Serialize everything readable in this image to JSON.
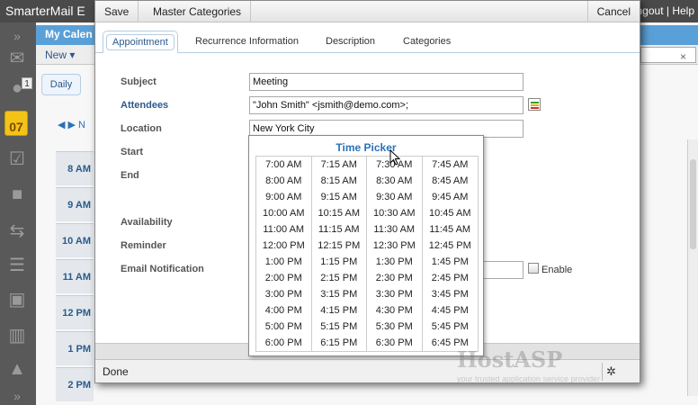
{
  "app": {
    "title": "SmarterMail E",
    "top_links": "ngout | Help",
    "header_title": "My Calen",
    "new_label": "New",
    "daily_tab": "Daily",
    "nav_month": "N",
    "inbox_count": "1",
    "calendar_day": "07",
    "time_slots": [
      "8 AM",
      "9 AM",
      "10 AM",
      "11 AM",
      "12 PM",
      "1 PM",
      "2 PM"
    ]
  },
  "modal": {
    "toolbar": {
      "save": "Save",
      "master_categories": "Master Categories",
      "cancel": "Cancel"
    },
    "tabs": [
      {
        "label": "Appointment",
        "active": true
      },
      {
        "label": "Recurrence Information",
        "active": false
      },
      {
        "label": "Description",
        "active": false
      },
      {
        "label": "Categories",
        "active": false
      }
    ],
    "fields": {
      "subject_label": "Subject",
      "subject_value": "Meeting",
      "attendees_label": "Attendees",
      "attendees_value": "\"John Smith\" <jsmith@demo.com>;",
      "location_label": "Location",
      "location_value": "New York City",
      "start_label": "Start",
      "end_label": "End",
      "availability_label": "Availability",
      "reminder_label": "Reminder",
      "email_notification_label": "Email Notification",
      "enable_label": "Enable"
    },
    "status": "Done"
  },
  "time_picker": {
    "title": "Time Picker",
    "times": [
      "7:00 AM",
      "7:15 AM",
      "7:30 AM",
      "7:45 AM",
      "8:00 AM",
      "8:15 AM",
      "8:30 AM",
      "8:45 AM",
      "9:00 AM",
      "9:15 AM",
      "9:30 AM",
      "9:45 AM",
      "10:00 AM",
      "10:15 AM",
      "10:30 AM",
      "10:45 AM",
      "11:00 AM",
      "11:15 AM",
      "11:30 AM",
      "11:45 AM",
      "12:00 PM",
      "12:15 PM",
      "12:30 PM",
      "12:45 PM",
      "1:00 PM",
      "1:15 PM",
      "1:30 PM",
      "1:45 PM",
      "2:00 PM",
      "2:15 PM",
      "2:30 PM",
      "2:45 PM",
      "3:00 PM",
      "3:15 PM",
      "3:30 PM",
      "3:45 PM",
      "4:00 PM",
      "4:15 PM",
      "4:30 PM",
      "4:45 PM",
      "5:00 PM",
      "5:15 PM",
      "5:30 PM",
      "5:45 PM",
      "6:00 PM",
      "6:15 PM",
      "6:30 PM",
      "6:45 PM"
    ]
  },
  "watermark": {
    "brand": "HostASP",
    "tagline": "your trusted application service provider"
  },
  "colors": {
    "accent_blue": "#2b73b8",
    "header_blue": "#5aa0d8",
    "rail_gray": "#595959"
  },
  "icons": [
    "chevron-double-down-icon",
    "mail-icon",
    "contacts-icon",
    "calendar-icon",
    "tasks-icon",
    "notes-icon",
    "sync-icon",
    "rss-icon",
    "files-icon",
    "reports-icon",
    "alert-icon",
    "address-book-icon",
    "bug-icon"
  ]
}
